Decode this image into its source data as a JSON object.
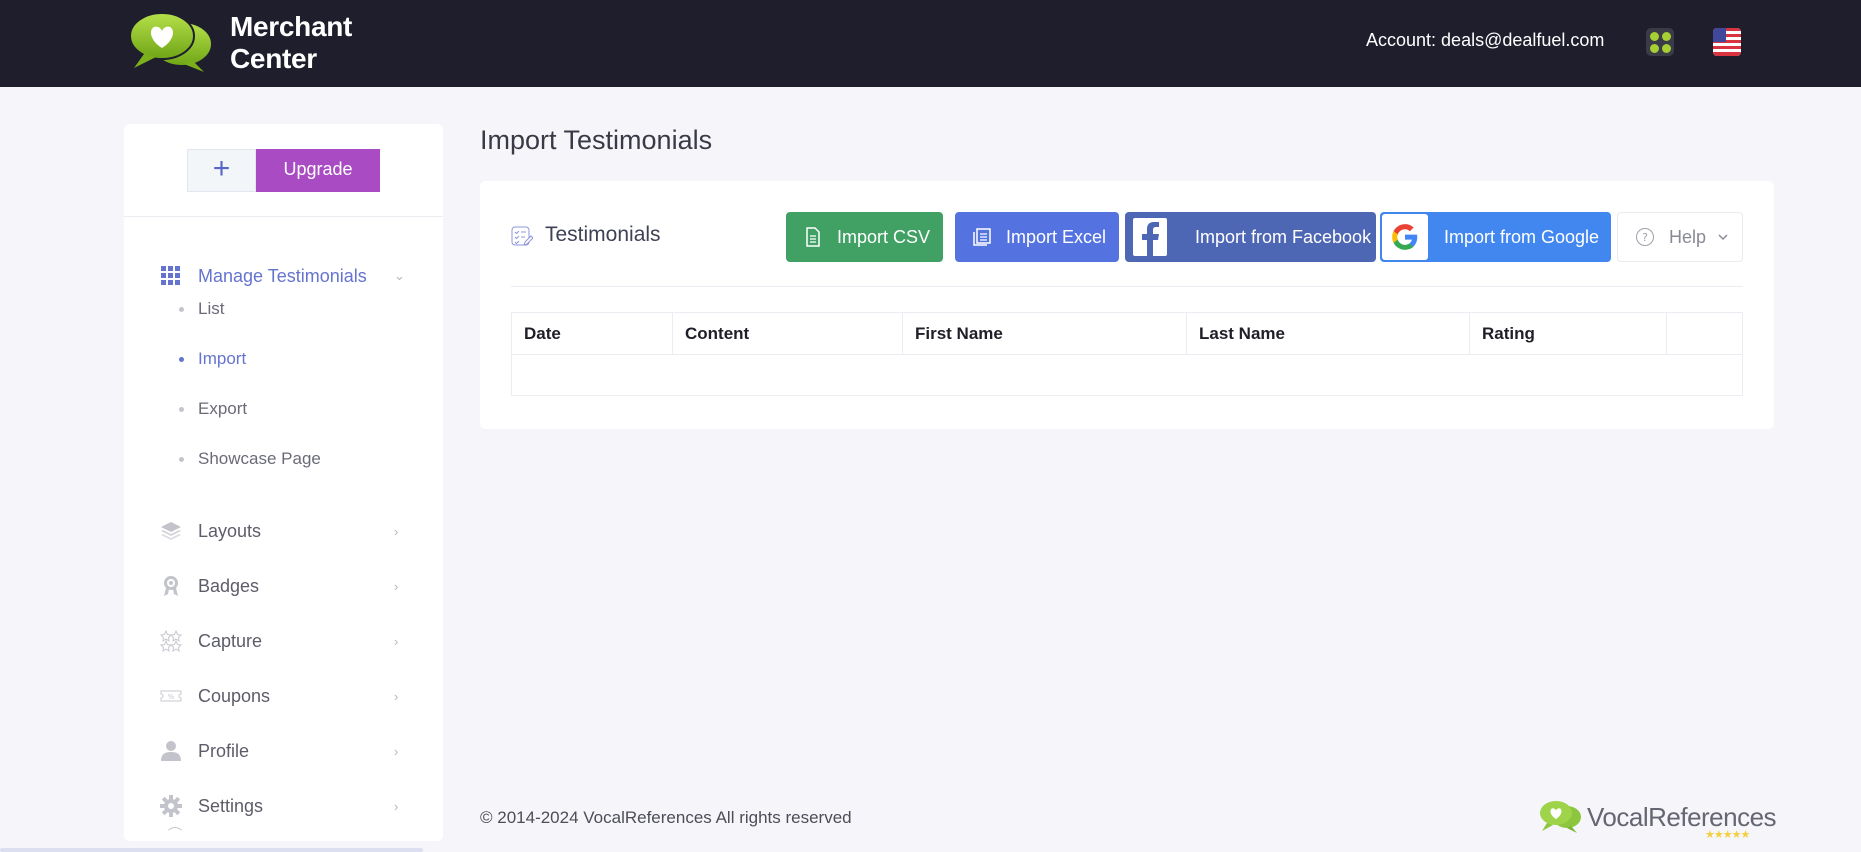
{
  "header": {
    "brand_line1": "Merchant",
    "brand_line2": "Center",
    "account_label": "Account: deals@dealfuel.com",
    "apps_icon": "apps-grid-icon",
    "language_icon": "us-flag-icon"
  },
  "sidebar": {
    "plus_label": "+",
    "upgrade_label": "Upgrade",
    "menu": [
      {
        "label": "Manage Testimonials",
        "icon": "grid-icon",
        "arrow": "⌄",
        "active": true
      },
      {
        "label": "Layouts",
        "icon": "layers-icon",
        "arrow": "›"
      },
      {
        "label": "Badges",
        "icon": "badge-icon",
        "arrow": "›"
      },
      {
        "label": "Capture",
        "icon": "stars-icon",
        "arrow": "›"
      },
      {
        "label": "Coupons",
        "icon": "coupon-icon",
        "arrow": "›"
      },
      {
        "label": "Profile",
        "icon": "user-icon",
        "arrow": "›"
      },
      {
        "label": "Settings",
        "icon": "gear-icon",
        "arrow": "›"
      }
    ],
    "submenu": [
      {
        "label": "List"
      },
      {
        "label": "Import",
        "active": true
      },
      {
        "label": "Export"
      },
      {
        "label": "Showcase Page"
      }
    ]
  },
  "main": {
    "page_title": "Import Testimonials",
    "card_title": "Testimonials",
    "buttons": {
      "import_csv": "Import CSV",
      "import_excel": "Import Excel",
      "import_facebook": "Import from Facebook",
      "import_google": "Import from Google",
      "help": "Help"
    },
    "colors": {
      "csv": "#41a064",
      "excel": "#5473e0",
      "facebook": "#4e67b5",
      "google": "#4287f0",
      "upgrade": "#a94cc3",
      "accent": "#6474cf"
    },
    "table": {
      "columns": [
        "Date",
        "Content",
        "First Name",
        "Last Name",
        "Rating",
        ""
      ],
      "rows": []
    }
  },
  "footer": {
    "copyright": "© 2014-2024 VocalReferences All rights reserved",
    "logo_text": "VocalReferences",
    "logo_stars": "★★★★★"
  }
}
